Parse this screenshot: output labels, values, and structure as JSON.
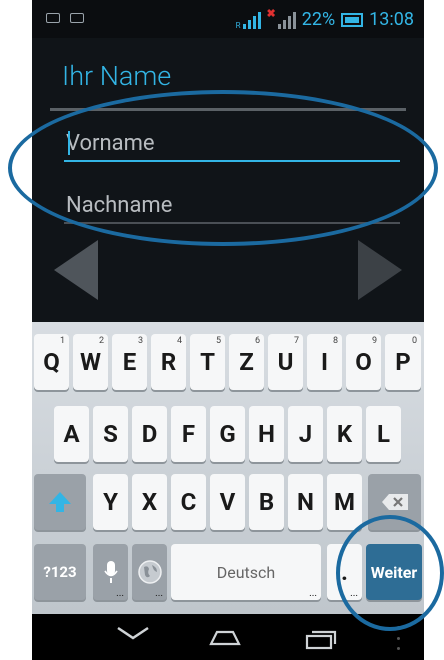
{
  "status_bar": {
    "battery_percent": "22%",
    "time": "13:08",
    "signal_label": "R"
  },
  "dialog": {
    "title": "Ihr Name",
    "first_name_placeholder": "Vorname",
    "last_name_placeholder": "Nachname"
  },
  "keyboard": {
    "row1": [
      {
        "label": "Q",
        "hint": "1"
      },
      {
        "label": "W",
        "hint": "2"
      },
      {
        "label": "E",
        "hint": "3"
      },
      {
        "label": "R",
        "hint": "4"
      },
      {
        "label": "T",
        "hint": "5"
      },
      {
        "label": "Z",
        "hint": "6"
      },
      {
        "label": "U",
        "hint": "7"
      },
      {
        "label": "I",
        "hint": "8"
      },
      {
        "label": "O",
        "hint": "9"
      },
      {
        "label": "P",
        "hint": "0"
      }
    ],
    "row2": [
      "A",
      "S",
      "D",
      "F",
      "G",
      "H",
      "J",
      "K",
      "L"
    ],
    "row3": [
      "Y",
      "X",
      "C",
      "V",
      "B",
      "N",
      "M"
    ],
    "symbols_label": "?123",
    "space_label": "Deutsch",
    "period_label": ".",
    "action_label": "Weiter",
    "dots": "..."
  },
  "colors": {
    "accent": "#33b5e5",
    "action_key": "#2e6d95",
    "annotation": "#1b6aa0"
  }
}
